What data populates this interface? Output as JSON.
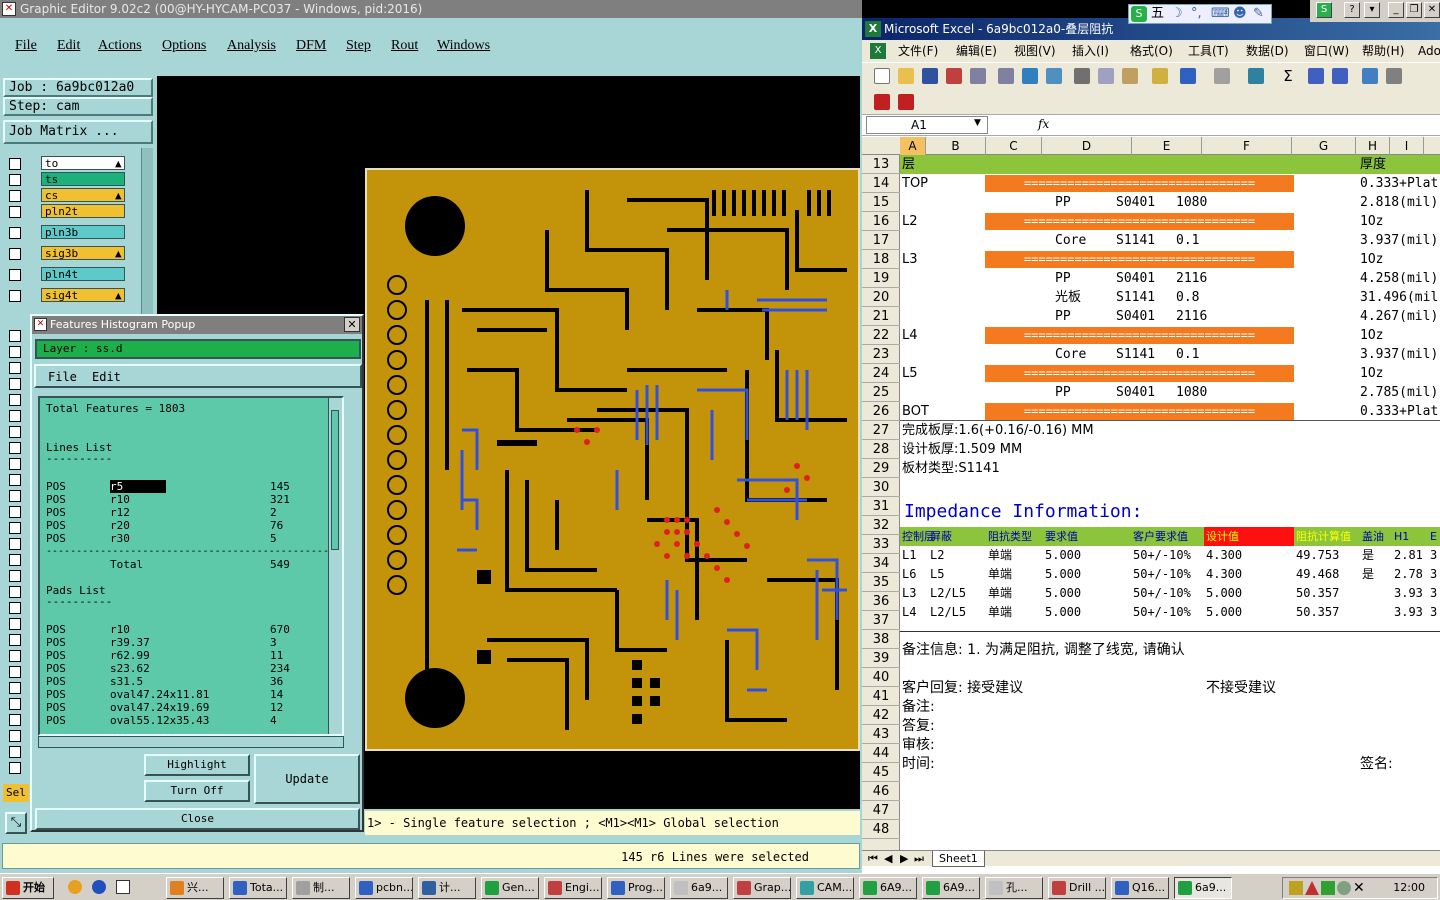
{
  "graphic_editor": {
    "title": "Graphic Editor 9.02c2 (00@HY-HYCAM-PC037 - Windows, pid:2016)",
    "menu": [
      "File",
      "Edit",
      "Actions",
      "Options",
      "Analysis",
      "DFM",
      "Step",
      "Rout",
      "Windows"
    ],
    "job": "Job : 6a9bc012a0",
    "step": "Step: cam",
    "job_matrix": "Job Matrix ...",
    "layers": [
      {
        "name": "to",
        "color": "#ffffff",
        "mark": "▲"
      },
      {
        "name": "ts",
        "color": "#1db07a",
        "mark": ""
      },
      {
        "name": "cs",
        "color": "#f0c030",
        "mark": "▲"
      },
      {
        "name": "pln2t",
        "color": "#f0c030",
        "mark": ""
      },
      {
        "name": "pln3b",
        "color": "#5ec9c9",
        "mark": ""
      },
      {
        "name": "sig3b",
        "color": "#f0c030",
        "mark": "▲"
      },
      {
        "name": "pln4t",
        "color": "#5ec9c9",
        "mark": ""
      },
      {
        "name": "sig4t",
        "color": "#f0c030",
        "mark": "▲"
      }
    ],
    "sel_label": "Sel",
    "status_hint": "1> - Single feature selection ; <M1><M1> Global selection",
    "message": "145 r6 Lines were selected"
  },
  "histogram_popup": {
    "title": "Features Histogram Popup",
    "layer_label": "Layer : ss.d",
    "menu": [
      "File",
      "Edit"
    ],
    "total": "Total Features = 1803",
    "lines_header": "Lines List",
    "underline": "----------",
    "lines": [
      {
        "pol": "POS",
        "sym": "r5",
        "count": "145"
      },
      {
        "pol": "POS",
        "sym": "r10",
        "count": "321"
      },
      {
        "pol": "POS",
        "sym": "r12",
        "count": "2"
      },
      {
        "pol": "POS",
        "sym": "r20",
        "count": "76"
      },
      {
        "pol": "POS",
        "sym": "r30",
        "count": "5"
      }
    ],
    "dash_line": "-----------------------------------------------",
    "total_label": "Total",
    "total_value": "549",
    "pads_header": "Pads List",
    "pads": [
      {
        "pol": "POS",
        "sym": "r10",
        "count": "670"
      },
      {
        "pol": "POS",
        "sym": "r39.37",
        "count": "3"
      },
      {
        "pol": "POS",
        "sym": "r62.99",
        "count": "11"
      },
      {
        "pol": "POS",
        "sym": "s23.62",
        "count": "234"
      },
      {
        "pol": "POS",
        "sym": "s31.5",
        "count": "36"
      },
      {
        "pol": "POS",
        "sym": "oval47.24x11.81",
        "count": "14"
      },
      {
        "pol": "POS",
        "sym": "oval47.24x19.69",
        "count": "12"
      },
      {
        "pol": "POS",
        "sym": "oval55.12x35.43",
        "count": "4"
      }
    ],
    "buttons": {
      "highlight": "Highlight",
      "turn_off": "Turn Off",
      "update": "Update",
      "close": "Close"
    }
  },
  "excel": {
    "title": "Microsoft Excel - 6a9bc012a0-叠层阻抗",
    "menu": [
      "文件(F)",
      "编辑(E)",
      "视图(V)",
      "插入(I)",
      "格式(O)",
      "工具(T)",
      "数据(D)",
      "窗口(W)",
      "帮助(H)",
      "Ado"
    ],
    "name_box": "A1",
    "fx": "fx",
    "columns": [
      "A",
      "B",
      "C",
      "D",
      "E",
      "F",
      "G",
      "H",
      "I"
    ],
    "rows": [
      "13",
      "14",
      "15",
      "16",
      "17",
      "18",
      "19",
      "20",
      "21",
      "22",
      "23",
      "24",
      "25",
      "26",
      "27",
      "28",
      "29",
      "30",
      "31",
      "32",
      "33",
      "34",
      "35",
      "36",
      "37",
      "38",
      "39",
      "40",
      "41",
      "42",
      "43",
      "44",
      "45",
      "46",
      "47",
      "48"
    ],
    "r13": {
      "a": "层",
      "h": "厚度"
    },
    "stack": [
      {
        "layer": "TOP",
        "bar": true,
        "h": "0.333+Plat"
      },
      {
        "d": "PP",
        "e": "S0401",
        "f": "1080",
        "h": "2.818(mil)"
      },
      {
        "layer": "L2",
        "bar": true,
        "h": "1Oz"
      },
      {
        "d": "Core",
        "e": "S1141",
        "f": "0.1",
        "h": "3.937(mil)"
      },
      {
        "layer": "L3",
        "bar": true,
        "h": "1Oz"
      },
      {
        "d": "PP",
        "e": "S0401",
        "f": "2116",
        "h": "4.258(mil)"
      },
      {
        "d": "光板",
        "e": "S1141",
        "f": "0.8",
        "h": "31.496(mil"
      },
      {
        "d": "PP",
        "e": "S0401",
        "f": "2116",
        "h": "4.267(mil)"
      },
      {
        "layer": "L4",
        "bar": true,
        "h": "1Oz"
      },
      {
        "d": "Core",
        "e": "S1141",
        "f": "0.1",
        "h": "3.937(mil)"
      },
      {
        "layer": "L5",
        "bar": true,
        "h": "1Oz"
      },
      {
        "d": "PP",
        "e": "S0401",
        "f": "1080",
        "h": "2.785(mil)"
      },
      {
        "layer": "BOT",
        "bar": true,
        "h": "0.333+Plat"
      }
    ],
    "bar_text": "================================",
    "finished": "完成板厚:1.6(+0.16/-0.16) MM",
    "design": "设计板厚:1.509 MM",
    "material": "板材类型:S1141",
    "impedance_title": "Impedance Information:",
    "imp_headers": [
      "控制层",
      "屏蔽",
      "阻抗类型",
      "要求值",
      "客户要求值",
      "设计值",
      "阻抗计算值",
      "盖油",
      "H1",
      "E"
    ],
    "imp_rows": [
      [
        "L1",
        "L2",
        "单端",
        "5.000",
        "50+/-10%",
        "4.300",
        "49.753",
        "是",
        "2.81",
        "3"
      ],
      [
        "L6",
        "L5",
        "单端",
        "5.000",
        "50+/-10%",
        "4.300",
        "49.468",
        "是",
        "2.78",
        "3"
      ],
      [
        "L3",
        "L2/L5",
        "单端",
        "5.000",
        "50+/-10%",
        "5.000",
        "50.357",
        "",
        "3.93",
        "3"
      ],
      [
        "L4",
        "L2/L5",
        "单端",
        "5.000",
        "50+/-10%",
        "5.000",
        "50.357",
        "",
        "3.93",
        "3"
      ]
    ],
    "note": "备注信息: 1. 为满足阻抗, 调整了线宽, 请确认",
    "reply": "客户回复: 接受建议",
    "reject": "不接受建议",
    "remark": "备注:",
    "answer": "答复:",
    "audit": "审核:",
    "time": "时间:",
    "sign": "签名:",
    "sheet": "Sheet1"
  },
  "ime": {
    "text": "五"
  },
  "taskbar": {
    "start": "开始",
    "tasks": [
      "兴...",
      "Tota...",
      "制...",
      "pcbn...",
      "计...",
      "Gen...",
      "Engi...",
      "Prog...",
      "6a9...",
      "Grap...",
      "CAM...",
      "6A9...",
      "6A9...",
      "孔...",
      "Drill ...",
      "Q16...",
      "6a9..."
    ],
    "clock": "12:00"
  }
}
